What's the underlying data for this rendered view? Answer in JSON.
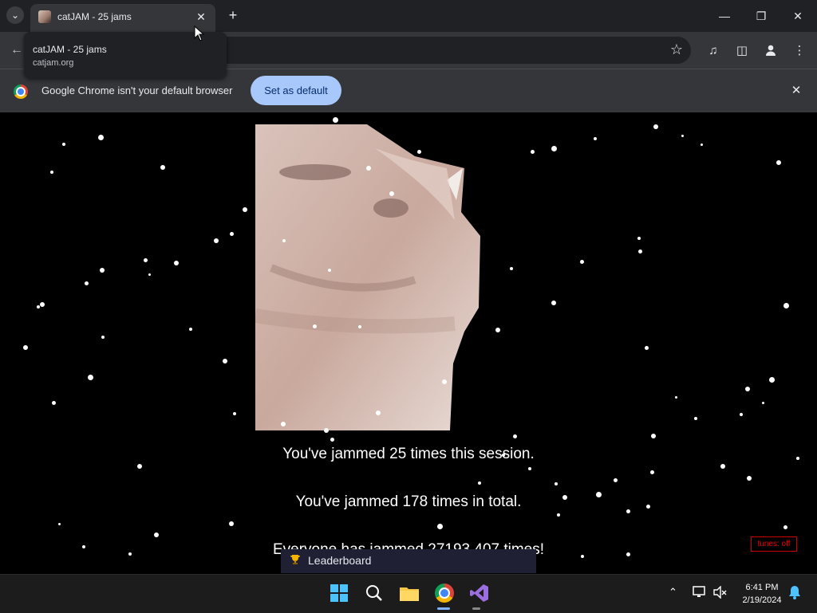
{
  "tabs": [
    {
      "title": "catJAM - 25 jams"
    }
  ],
  "tooltip": {
    "title": "catJAM - 25 jams",
    "url": "catjam.org"
  },
  "infobar": {
    "message": "Google Chrome isn't your default browser",
    "button_label": "Set as default"
  },
  "page": {
    "stats": [
      "You've jammed 25 times this session.",
      "You've jammed 178 times in total.",
      "Everyone has jammed 27193 407 times!"
    ],
    "tunes_label": "tunes: off",
    "leaderboard_label": "Leaderboard"
  },
  "taskbar": {
    "time": "6:41 PM",
    "date": "2/19/2024"
  },
  "colors": {
    "accent": "#a8c7fa",
    "tunes": "#e00000"
  }
}
